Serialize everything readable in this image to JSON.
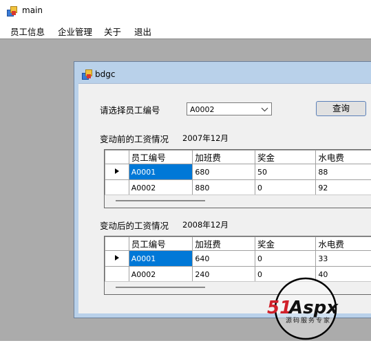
{
  "window": {
    "title": "main"
  },
  "menu": {
    "items": [
      "员工信息",
      "企业管理",
      "关于",
      "退出"
    ]
  },
  "child": {
    "title": "bdgc",
    "select_label": "请选择员工编号",
    "employee_id": "A0002",
    "query_button": "查询",
    "before": {
      "label": "变动前的工资情况",
      "date": "2007年12月",
      "columns": [
        "员工编号",
        "加班费",
        "奖金",
        "水电费"
      ],
      "rows": [
        [
          "A0001",
          "680",
          "50",
          "88"
        ],
        [
          "A0002",
          "880",
          "0",
          "92"
        ]
      ]
    },
    "after": {
      "label": "变动后的工资情况",
      "date": "2008年12月",
      "columns": [
        "员工编号",
        "加班费",
        "奖金",
        "水电费"
      ],
      "rows": [
        [
          "A0001",
          "640",
          "0",
          "33"
        ],
        [
          "A0002",
          "240",
          "0",
          "40"
        ]
      ]
    }
  },
  "watermark": {
    "brand": "51Aspx",
    "tagline": "源码服务专家"
  },
  "colors": {
    "selection": "#0078d7",
    "mdi_background": "#ababab",
    "child_frame": "#b9d1ea"
  }
}
